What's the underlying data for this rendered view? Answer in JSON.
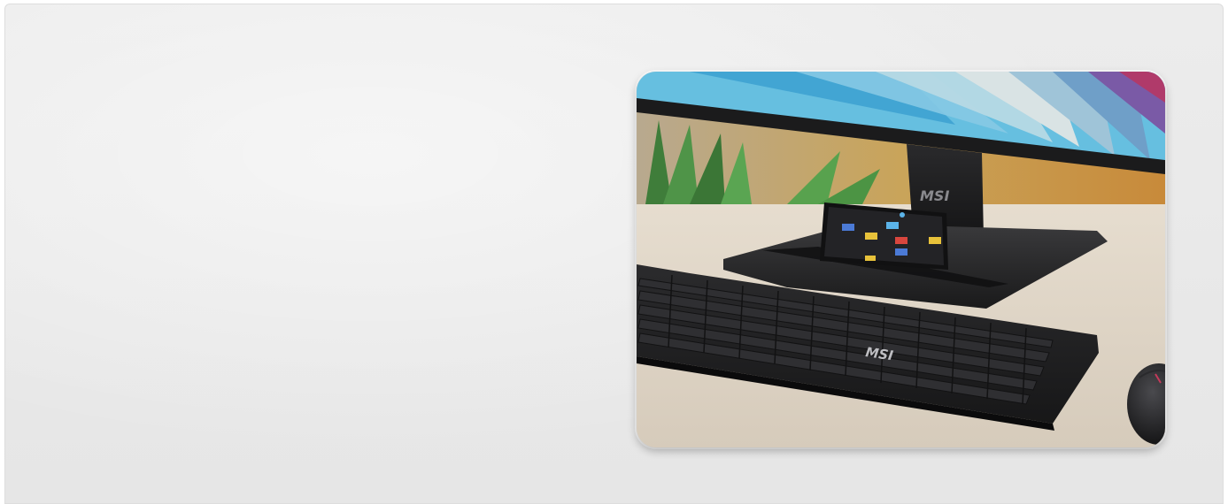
{
  "hero": {
    "image": {
      "monitor_logo": "MSI",
      "keyboard_logo": "MSI"
    }
  },
  "colors": {
    "background": "#e9e9e9",
    "desk": "#ddd2c3",
    "device_black": "#1d1d1f"
  }
}
